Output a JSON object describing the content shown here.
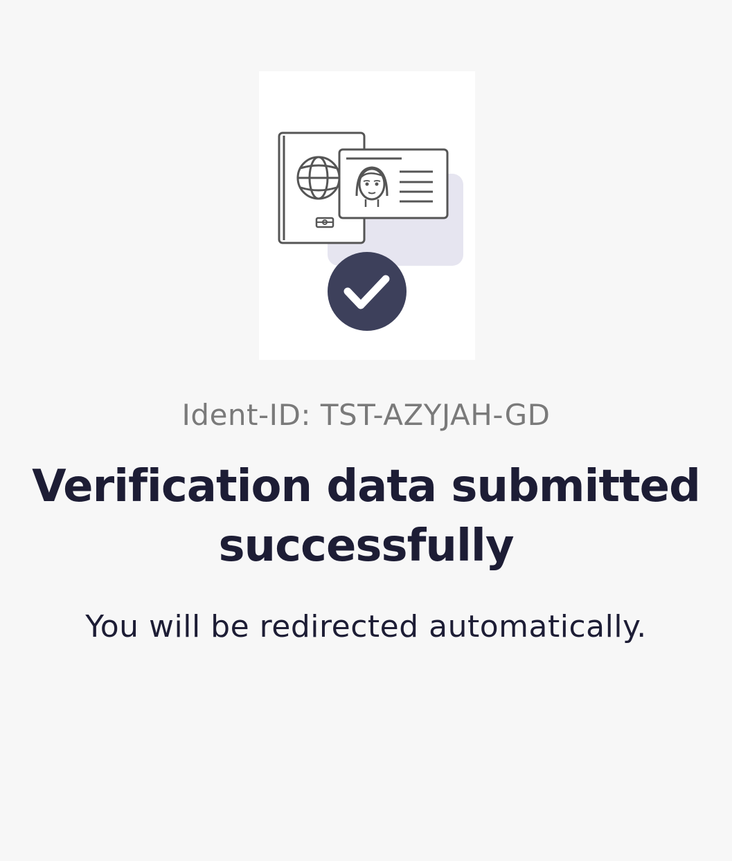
{
  "illustration": {
    "icons": [
      "passport-icon",
      "id-card-icon",
      "checkmark-icon"
    ],
    "colors": {
      "card_background": "#ffffff",
      "outline": "#555555",
      "highlight_shape": "#e6e5f0",
      "check_badge": "#3d405b",
      "check_mark": "#ffffff"
    }
  },
  "ident": {
    "text": "Ident-ID: TST-AZYJAH-GD"
  },
  "status": {
    "title": "Verification data submitted successfully",
    "message": "You will be redirected automatically."
  },
  "colors": {
    "page_background": "#f7f7f7",
    "title_text": "#1d1d35",
    "muted_text": "#7a7a7a"
  }
}
